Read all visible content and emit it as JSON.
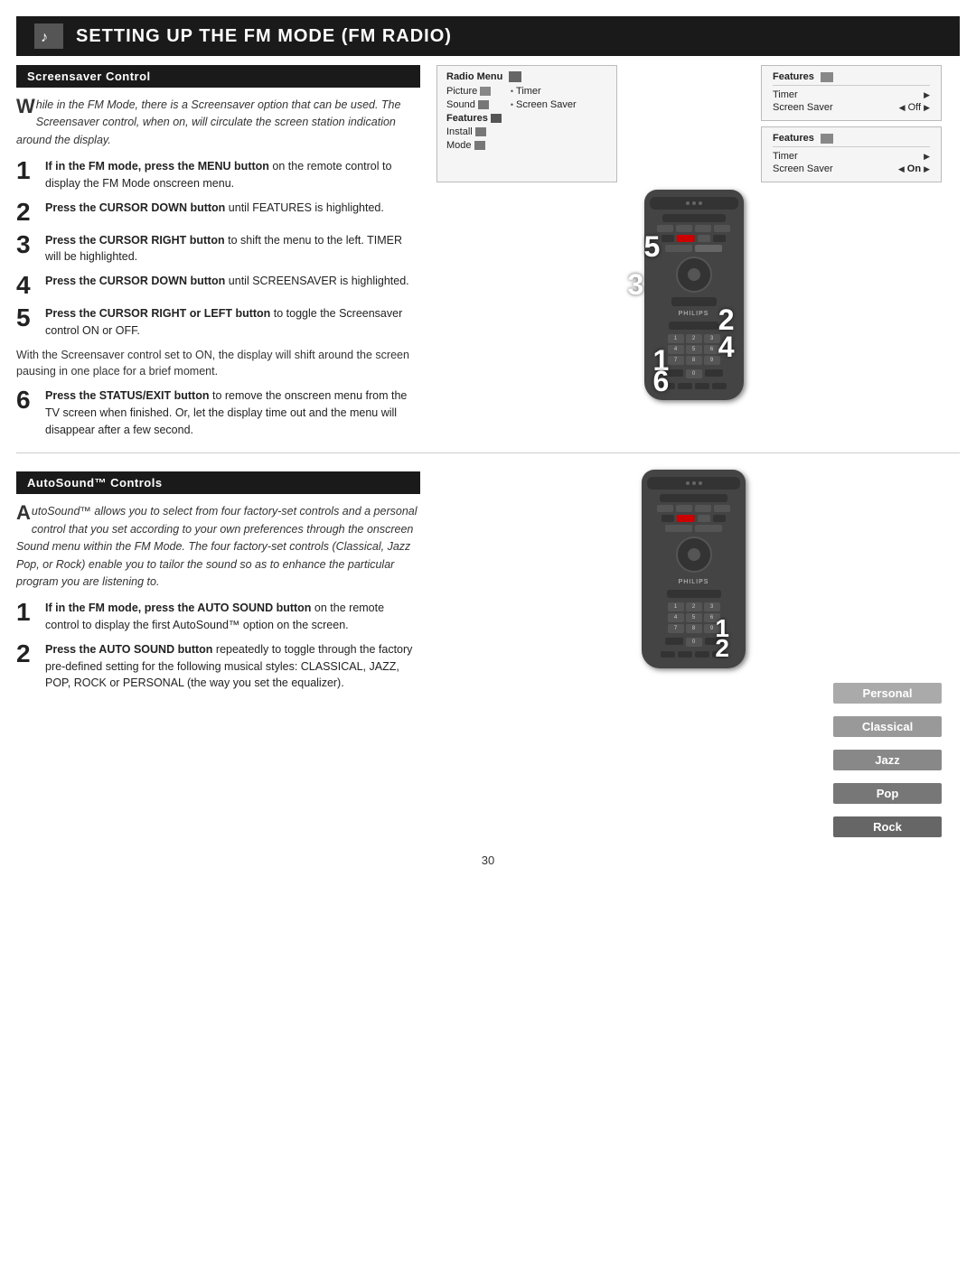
{
  "header": {
    "title": "Setting up the FM Mode (FM Radio)",
    "icon": "♪"
  },
  "screensaver_section": {
    "title": "Screensaver Control",
    "intro": {
      "drop_cap": "W",
      "text": "hile in the FM Mode, there is a Screensaver option that can be used. The Screensaver control, when on, will circulate the screen station indication around the display."
    },
    "steps": [
      {
        "num": "1",
        "bold": "If in the FM mode, press the MENU button",
        "text": "on the remote control to display the FM Mode onscreen menu."
      },
      {
        "num": "2",
        "bold": "Press the CURSOR DOWN button",
        "text": " until FEATURES is highlighted."
      },
      {
        "num": "3",
        "bold": "Press the CURSOR RIGHT button",
        "text": " to shift the menu to the left. TIMER will be highlighted."
      },
      {
        "num": "4",
        "bold": "Press the CURSOR DOWN button",
        "text": " until SCREENSAVER is highlighted."
      },
      {
        "num": "5",
        "bold": "Press the CURSOR RIGHT or LEFT button",
        "text": " to toggle the Screensaver control ON or OFF."
      }
    ],
    "note": "With the Screensaver control set to ON, the display will shift around the screen pausing in one place for a brief moment.",
    "step6": {
      "num": "6",
      "bold": "Press the STATUS/EXIT button",
      "text": " to remove the onscreen menu from the TV screen when finished. Or, let the display time out and the menu will disappear after a few second."
    }
  },
  "radio_menu": {
    "title": "Radio Menu",
    "items_left": [
      "Picture",
      "Sound",
      "Features",
      "Install",
      "Mode"
    ],
    "items_right": [
      "• Timer",
      "• Screen Saver"
    ]
  },
  "features_screen_off": {
    "title": "Features",
    "timer_label": "Timer",
    "timer_arrow": "▶",
    "screensaver_label": "Screen Saver",
    "screensaver_left": "◀",
    "screensaver_value": "Off",
    "screensaver_right": "▶"
  },
  "features_screen_on": {
    "title": "Features",
    "timer_label": "Timer",
    "timer_arrow": "▶",
    "screensaver_label": "Screen Saver",
    "screensaver_left": "◀",
    "screensaver_value": "On",
    "screensaver_right": "▶"
  },
  "autosound_section": {
    "title": "AutoSound™ Controls",
    "intro": {
      "drop_cap": "A",
      "text": "utoSound™ allows you to select from four factory-set controls and a personal control that you set according to your own preferences through the onscreen Sound menu within the FM Mode. The four factory-set controls (Classical, Jazz Pop, or Rock) enable you to tailor the sound so as to enhance the particular program you are listening to."
    },
    "steps": [
      {
        "num": "1",
        "bold": "If in the FM mode, press the AUTO SOUND button",
        "text": " on the remote control to display the first AutoSound™ option on the screen."
      },
      {
        "num": "2",
        "bold": "Press the AUTO SOUND button",
        "text": " repeatedly to toggle through the factory pre-defined setting for the following musical styles: CLASSICAL, JAZZ, POP, ROCK or PERSONAL (the way you set the equalizer)."
      }
    ],
    "sound_options": [
      "Personal",
      "Classical",
      "Jazz",
      "Pop",
      "Rock"
    ],
    "step_overlays_screensaver": [
      "3",
      "5",
      "2",
      "4"
    ],
    "step_overlays_autosound": [
      "1",
      "2"
    ]
  },
  "page_number": "30"
}
